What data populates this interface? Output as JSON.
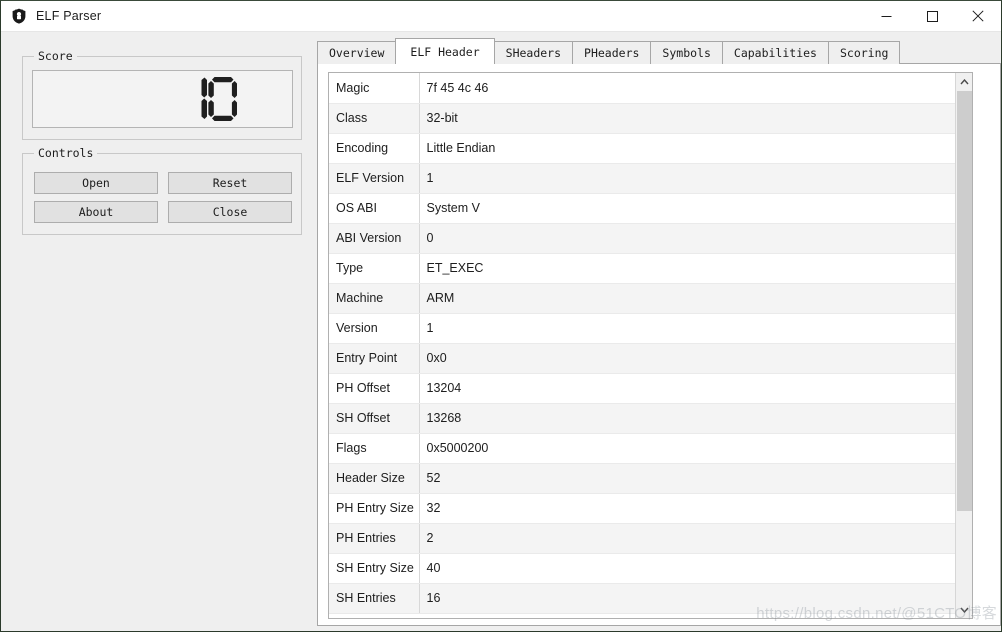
{
  "window": {
    "title": "ELF Parser",
    "icon": "shield-icon",
    "background_color": "#efefef",
    "controls": {
      "minimize": "minimize-icon",
      "maximize": "maximize-icon",
      "close": "close-icon"
    }
  },
  "left_panel": {
    "score_group": {
      "label": "Score",
      "display_value": "10",
      "display_type": "seven-segment-lcd"
    },
    "controls_group": {
      "label": "Controls",
      "buttons": [
        {
          "label": "Open",
          "name": "open-button"
        },
        {
          "label": "Reset",
          "name": "reset-button"
        },
        {
          "label": "About",
          "name": "about-button"
        },
        {
          "label": "Close",
          "name": "close-button"
        }
      ]
    }
  },
  "tabs": [
    {
      "label": "Overview",
      "active": false
    },
    {
      "label": "ELF Header",
      "active": true
    },
    {
      "label": "SHeaders",
      "active": false
    },
    {
      "label": "PHeaders",
      "active": false
    },
    {
      "label": "Symbols",
      "active": false
    },
    {
      "label": "Capabilities",
      "active": false
    },
    {
      "label": "Scoring",
      "active": false
    }
  ],
  "elf_header_table": {
    "rows": [
      {
        "field": "Magic",
        "value": "7f 45 4c 46"
      },
      {
        "field": "Class",
        "value": "32-bit"
      },
      {
        "field": "Encoding",
        "value": "Little Endian"
      },
      {
        "field": "ELF Version",
        "value": "1"
      },
      {
        "field": "OS ABI",
        "value": "System V"
      },
      {
        "field": "ABI Version",
        "value": "0"
      },
      {
        "field": "Type",
        "value": "ET_EXEC"
      },
      {
        "field": "Machine",
        "value": "ARM"
      },
      {
        "field": "Version",
        "value": "1"
      },
      {
        "field": "Entry Point",
        "value": "0x0"
      },
      {
        "field": "PH Offset",
        "value": "13204"
      },
      {
        "field": "SH Offset",
        "value": "13268"
      },
      {
        "field": "Flags",
        "value": "0x5000200"
      },
      {
        "field": "Header Size",
        "value": "52"
      },
      {
        "field": "PH Entry Size",
        "value": "32"
      },
      {
        "field": "PH Entries",
        "value": "2"
      },
      {
        "field": "SH Entry Size",
        "value": "40"
      },
      {
        "field": "SH Entries",
        "value": "16"
      }
    ]
  },
  "scrollbar": {
    "up_arrow": "chevron-up-icon",
    "down_arrow": "chevron-down-icon",
    "thumb_position_percent": 0,
    "thumb_size_percent": 80
  },
  "watermark": {
    "text": "https://blog.csdn.net/@51CTO博客"
  }
}
